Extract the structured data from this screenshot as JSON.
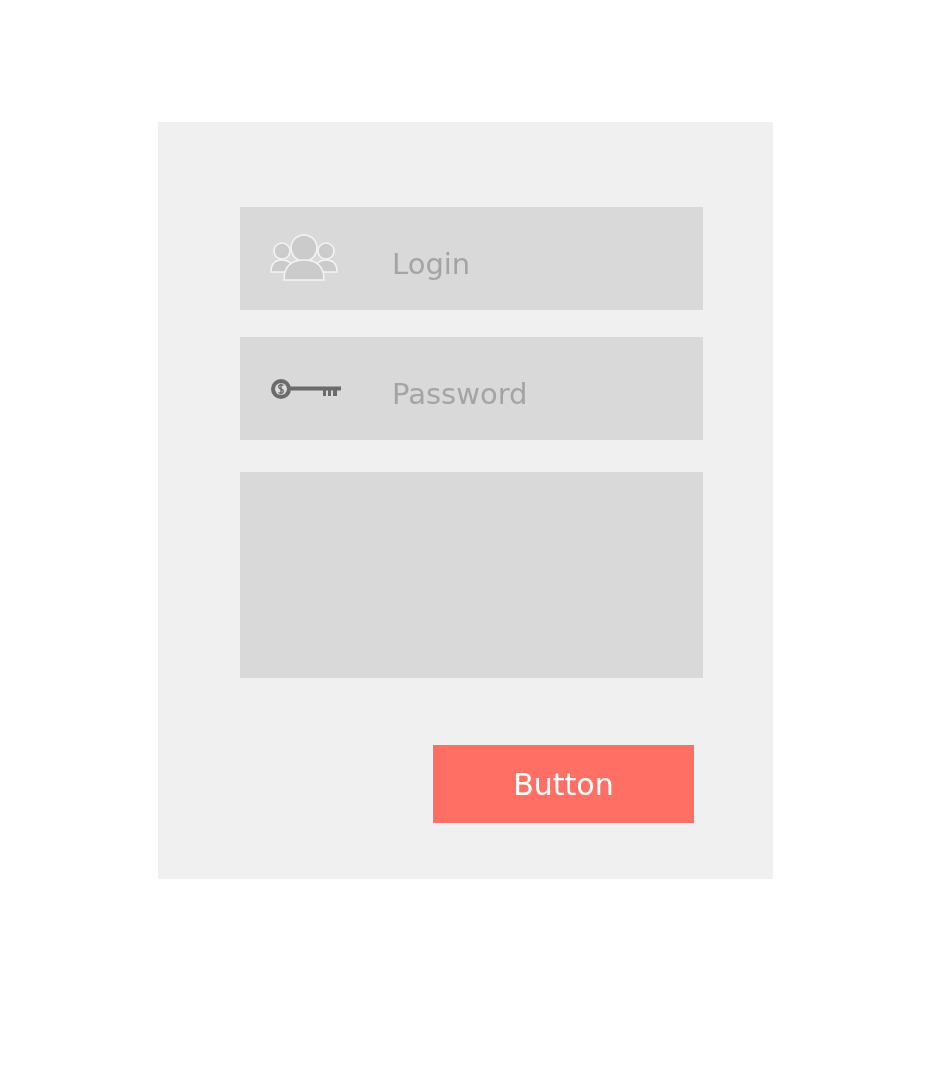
{
  "form": {
    "fields": [
      {
        "kind": "user",
        "placeholder": "Login"
      },
      {
        "kind": "key",
        "placeholder": "Password"
      }
    ],
    "message_area": {
      "kind": "textarea"
    },
    "button": {
      "label": "Button"
    }
  }
}
